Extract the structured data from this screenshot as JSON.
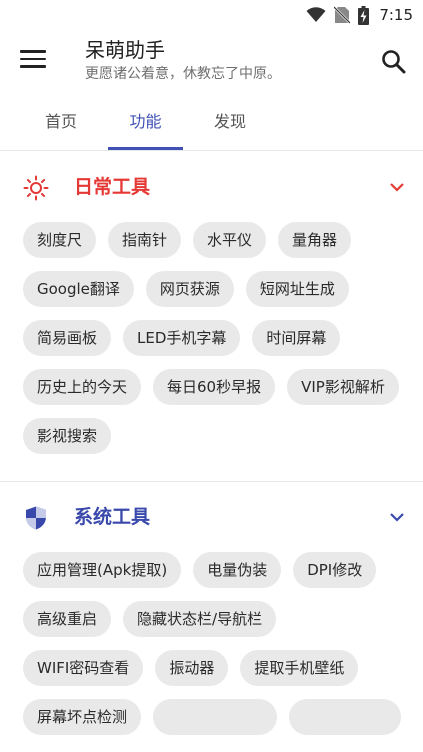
{
  "status_bar": {
    "time": "7:15",
    "icons": [
      "wifi-icon",
      "no-sim-icon",
      "battery-charging-icon"
    ]
  },
  "app_bar": {
    "title": "呆萌助手",
    "subtitle": "更愿诸公着意，休教忘了中原。",
    "menu_icon": "menu-icon",
    "search_icon": "search-icon"
  },
  "tabs": [
    {
      "label": "首页",
      "active": false
    },
    {
      "label": "功能",
      "active": true
    },
    {
      "label": "发现",
      "active": false
    }
  ],
  "colors": {
    "accent": "#3f51b5",
    "daily_red": "#e53935",
    "system_blue": "#3949ab",
    "chip_bg": "#e9e9e9"
  },
  "sections": [
    {
      "title": "日常工具",
      "icon": "sun-icon",
      "chevron": "chevron-down-icon",
      "tools": [
        "刻度尺",
        "指南针",
        "水平仪",
        "量角器",
        "Google翻译",
        "网页获源",
        "短网址生成",
        "简易画板",
        "LED手机字幕",
        "时间屏幕",
        "历史上的今天",
        "每日60秒早报",
        "VIP影视解析",
        "影视搜索"
      ]
    },
    {
      "title": "系统工具",
      "icon": "shield-icon",
      "chevron": "chevron-down-icon",
      "tools": [
        "应用管理(Apk提取)",
        "电量伪装",
        "DPI修改",
        "高级重启",
        "隐藏状态栏/导航栏",
        "WIFI密码查看",
        "振动器",
        "提取手机壁纸",
        "屏幕坏点检测",
        "",
        ""
      ]
    }
  ]
}
